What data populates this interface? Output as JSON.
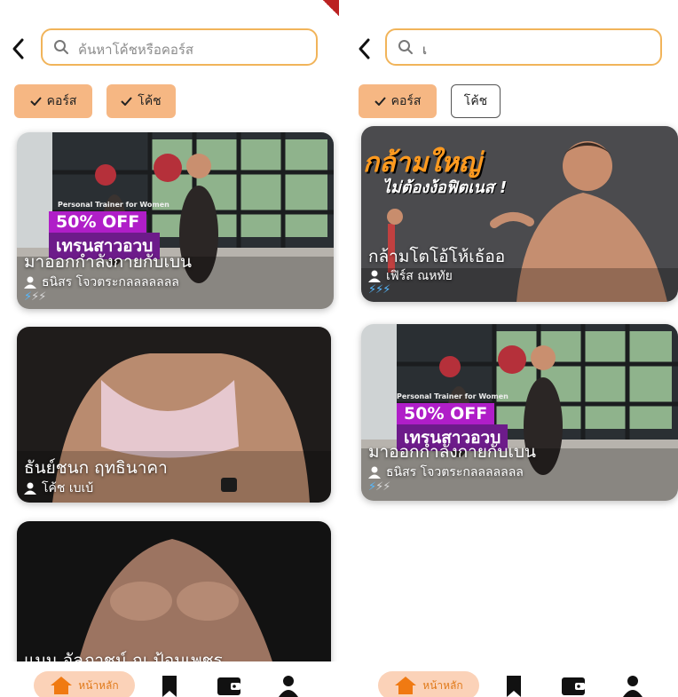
{
  "colors": {
    "accent": "#f6b783",
    "search_border": "#f1b45a",
    "tag_magenta": "#b01ec8",
    "level_active": "#55b9ff",
    "level_inactive": "#d8d8d8"
  },
  "left": {
    "back_icon": "chevron-left-icon",
    "search": {
      "placeholder": "ค้นหาโค้ชหรือคอร์ส",
      "icon": "search-icon"
    },
    "filters": [
      {
        "label": "คอร์ส",
        "selected": true
      },
      {
        "label": "โค้ช",
        "selected": true
      }
    ],
    "cards": [
      {
        "title": "มาออกกำลังกายกับเบน",
        "coach": "ธนิสร โจวตระกลลลลลลล",
        "level": 1,
        "banner": {
          "small": "Personal Trainer for Women",
          "discount": "50% OFF",
          "headline": "เทรนสาวอวบ"
        }
      },
      {
        "title": "ธันย์ชนก ฤทธินาคา",
        "coach": "โค้ช เบเบ้"
      },
      {
        "title": "แมน อัลภาชน์ ณ ป้อมเพชร"
      }
    ],
    "nav": {
      "home_label": "หน้าหลัก"
    }
  },
  "right": {
    "back_icon": "chevron-left-icon",
    "search": {
      "value": "เ",
      "icon": "search-icon"
    },
    "filters": [
      {
        "label": "คอร์ส",
        "selected": true
      },
      {
        "label": "โค้ช",
        "selected": false
      }
    ],
    "cards": [
      {
        "title": "กล้ามโตโอ้โห้เธ้ออ",
        "coach": "เฟิร์ส ณหทัย",
        "level": 3,
        "banner": {
          "headline1": "กล้ามใหญ่",
          "headline2": "ไม่ต้องง้อฟิตเนส !"
        }
      },
      {
        "title": "มาออกกำลังกายกับเบน",
        "coach": "ธนิสร โจวตระกลลลลลลล",
        "level": 1,
        "banner": {
          "small": "Personal Trainer for Women",
          "discount": "50% OFF",
          "headline": "เทรนสาวอวบ"
        }
      }
    ],
    "nav": {
      "home_label": "หน้าหลัก"
    }
  }
}
